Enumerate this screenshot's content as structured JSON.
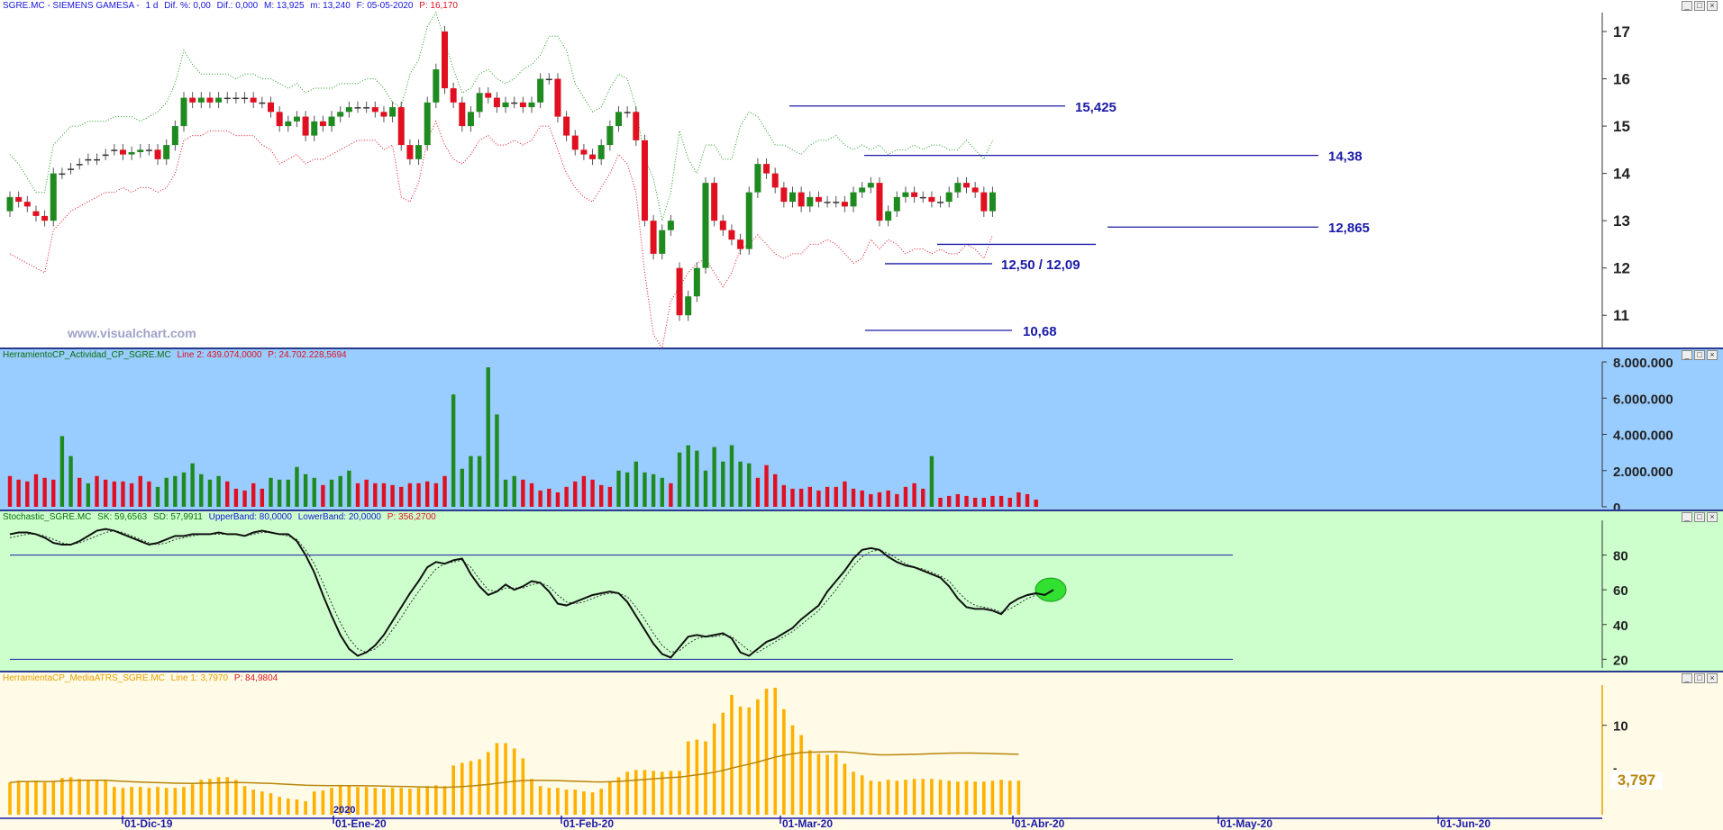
{
  "panels": {
    "price": {
      "title": {
        "symbol": "SGRE.MC - SIEMENS GAMESA -",
        "period": "1 d",
        "dif_pct": "Dif. %: 0,00",
        "dif": "Dif.: 0,000",
        "max": "M: 13,925",
        "min": "m: 13,240",
        "fecha": "F: 05-05-2020",
        "p": "P: 16,170"
      },
      "watermark": "www.visualchart.com"
    },
    "volume": {
      "title": {
        "name": "HerramientoCP_Actividad_CP_SGRE.MC",
        "line": "Line 2: 439.074,0000",
        "p": "P: 24.702.228,5694"
      }
    },
    "stochastic": {
      "title": {
        "name": "Stochastic_SGRE.MC",
        "sk": "SK: 59,6563",
        "sd": "SD: 57,9911",
        "upper": "UpperBand: 80,0000",
        "lower": "LowerBand: 20,0000",
        "p": "P: 356,2700"
      }
    },
    "atr": {
      "title": {
        "name": "HerramientaCP_MediaATRS_SGRE.MC",
        "line": "Line 1: 3,7970",
        "p": "P: 84,9804"
      },
      "last_value": "3,797"
    }
  },
  "colors": {
    "bull": "#1f8a1f",
    "bear": "#e01020",
    "neutral": "#1414d8",
    "level": "#1a1aa8",
    "upper_band": "#1f9d1f",
    "lower_band": "#e01020",
    "vol_bg": "#99ccff",
    "stoch_bg": "#ccffcc",
    "atr_bg": "#fffbe6",
    "atr_bar": "#ffb000",
    "atr_avg": "#b8860b"
  },
  "chart_data": [
    {
      "type": "candlestick",
      "title": "SGRE.MC - SIEMENS GAMESA - 1 d",
      "y_ticks": [
        "11",
        "12",
        "13",
        "14",
        "15",
        "16",
        "17"
      ],
      "ylim": [
        10.3,
        17.4
      ],
      "x_labels": [
        "01-Dic-19",
        "01-Ene-20",
        "01-Feb-20",
        "01-Mar-20",
        "01-Abr-20",
        "01-May-20",
        "01-Jun-20"
      ],
      "year_label": "2020",
      "levels": [
        {
          "label": "15,425",
          "value": 15.425
        },
        {
          "label": "14,38",
          "value": 14.38
        },
        {
          "label": "12,865",
          "value": 12.865
        },
        {
          "label": "12,50 / 12,09",
          "value": 12.5,
          "value2": 12.09
        },
        {
          "label": "10,68",
          "value": 10.68
        }
      ],
      "closes": [
        13.5,
        13.4,
        13.3,
        13.1,
        13.0,
        14.0,
        14.0,
        14.1,
        14.2,
        14.3,
        14.3,
        14.4,
        14.5,
        14.4,
        14.45,
        14.5,
        14.5,
        14.3,
        14.6,
        15.0,
        15.6,
        15.5,
        15.6,
        15.5,
        15.6,
        15.6,
        15.6,
        15.6,
        15.5,
        15.5,
        15.3,
        15.0,
        15.1,
        15.2,
        14.8,
        15.1,
        15.0,
        15.2,
        15.3,
        15.4,
        15.4,
        15.4,
        15.3,
        15.2,
        15.4,
        14.6,
        14.3,
        14.6,
        15.5,
        16.2,
        15.8,
        15.5,
        15.0,
        15.3,
        15.7,
        15.6,
        15.4,
        15.5,
        15.5,
        15.4,
        15.5,
        16.0,
        16.0,
        15.2,
        14.8,
        14.5,
        14.4,
        14.3,
        14.6,
        15.0,
        15.3,
        15.3,
        14.7,
        13.0,
        12.3,
        12.8,
        13.0,
        11.0,
        11.4,
        12.0,
        13.8,
        13.0,
        12.8,
        12.6,
        12.4,
        13.6,
        14.2,
        14.0,
        13.7,
        13.4,
        13.6,
        13.3,
        13.5,
        13.4,
        13.4,
        13.4,
        13.3,
        13.6,
        13.7,
        13.8,
        13.0,
        13.2,
        13.5,
        13.6,
        13.5,
        13.5,
        13.4,
        13.4,
        13.6,
        13.8,
        13.7,
        13.6,
        13.2,
        13.6
      ],
      "opens": [
        13.2,
        13.5,
        13.4,
        13.2,
        13.1,
        13.0,
        14.0,
        14.1,
        14.2,
        14.3,
        14.3,
        14.4,
        14.5,
        14.5,
        14.4,
        14.45,
        14.5,
        14.5,
        14.3,
        14.6,
        15.0,
        15.6,
        15.5,
        15.6,
        15.5,
        15.6,
        15.6,
        15.6,
        15.6,
        15.5,
        15.5,
        15.3,
        15.0,
        15.1,
        15.2,
        14.8,
        15.1,
        15.0,
        15.2,
        15.3,
        15.4,
        15.4,
        15.4,
        15.3,
        15.2,
        15.4,
        14.6,
        14.3,
        14.6,
        15.5,
        17.0,
        15.8,
        15.5,
        15.0,
        15.3,
        15.7,
        15.6,
        15.4,
        15.5,
        15.5,
        15.4,
        15.5,
        16.0,
        16.0,
        15.2,
        14.8,
        14.5,
        14.4,
        14.3,
        14.6,
        15.0,
        15.3,
        15.3,
        14.7,
        13.0,
        12.3,
        12.8,
        12.0,
        11.0,
        11.4,
        12.0,
        13.8,
        13.0,
        12.8,
        12.6,
        12.4,
        13.6,
        14.2,
        14.0,
        13.7,
        13.4,
        13.6,
        13.3,
        13.5,
        13.4,
        13.4,
        13.4,
        13.3,
        13.6,
        13.7,
        13.8,
        13.0,
        13.2,
        13.5,
        13.6,
        13.5,
        13.5,
        13.4,
        13.4,
        13.6,
        13.8,
        13.7,
        13.6,
        13.2
      ],
      "upper_band": [
        14.4,
        14.2,
        13.9,
        13.6,
        13.6,
        14.6,
        14.8,
        15.0,
        15.0,
        15.1,
        15.1,
        15.1,
        15.2,
        15.2,
        15.2,
        15.1,
        15.2,
        15.3,
        15.5,
        15.9,
        16.6,
        16.3,
        16.1,
        16.1,
        16.1,
        16.1,
        16.0,
        16.1,
        16.1,
        16.0,
        16.0,
        15.9,
        15.8,
        15.9,
        15.7,
        15.8,
        15.8,
        15.8,
        15.9,
        15.9,
        15.9,
        16.0,
        16.0,
        15.8,
        15.5,
        15.4,
        16.1,
        16.4,
        17.1,
        17.4,
        16.8,
        16.2,
        15.7,
        15.8,
        16.1,
        16.2,
        16.0,
        15.9,
        16.0,
        16.2,
        16.3,
        16.5,
        16.9,
        16.9,
        16.6,
        15.9,
        15.6,
        15.3,
        15.4,
        15.8,
        16.1,
        16.0,
        15.4,
        14.3,
        13.9,
        13.0,
        13.6,
        14.9,
        14.3,
        14.0,
        14.6,
        14.6,
        14.3,
        14.3,
        15.0,
        15.3,
        15.2,
        14.9,
        14.6,
        14.6,
        14.5,
        14.4,
        14.6,
        14.7,
        14.7,
        14.8,
        14.6,
        14.5,
        14.6,
        14.5,
        14.6,
        14.4,
        14.5,
        14.5,
        14.6,
        14.5,
        14.6,
        14.6,
        14.5,
        14.5,
        14.7,
        14.5,
        14.3,
        14.7
      ],
      "lower_band": [
        12.3,
        12.2,
        12.1,
        12.0,
        11.9,
        12.8,
        13.0,
        13.2,
        13.3,
        13.4,
        13.5,
        13.6,
        13.6,
        13.7,
        13.6,
        13.7,
        13.7,
        13.6,
        13.7,
        14.0,
        14.7,
        14.8,
        14.8,
        14.9,
        14.9,
        14.9,
        14.8,
        14.8,
        14.8,
        14.6,
        14.5,
        14.2,
        14.3,
        14.4,
        14.2,
        14.3,
        14.3,
        14.4,
        14.5,
        14.6,
        14.7,
        14.7,
        14.7,
        14.5,
        14.6,
        13.5,
        13.4,
        13.8,
        14.7,
        15.1,
        14.6,
        14.3,
        14.2,
        14.4,
        14.7,
        14.8,
        14.6,
        14.6,
        14.7,
        14.6,
        14.7,
        15.0,
        15.0,
        14.5,
        14.0,
        13.7,
        13.5,
        13.4,
        13.7,
        14.0,
        14.4,
        14.2,
        13.6,
        11.9,
        10.6,
        10.3,
        11.3,
        11.6,
        11.9,
        12.1,
        12.2,
        11.9,
        11.6,
        11.9,
        12.4,
        12.5,
        12.7,
        12.5,
        12.3,
        12.2,
        12.3,
        12.3,
        12.5,
        12.5,
        12.6,
        12.5,
        12.3,
        12.1,
        12.2,
        12.6,
        12.4,
        12.6,
        12.5,
        12.3,
        12.4,
        12.4,
        12.3,
        12.4,
        12.3,
        12.3,
        12.5,
        12.4,
        12.2,
        12.7
      ]
    },
    {
      "type": "bar",
      "title": "HerramientoCP_Actividad_CP_SGRE.MC",
      "y_ticks": [
        "0",
        "2.000.000",
        "4.000.000",
        "6.000.000",
        "8.000.000"
      ],
      "ylim": [
        0,
        8000000
      ],
      "values": [
        1700000,
        1500000,
        1400000,
        1800000,
        1600000,
        1500000,
        3900000,
        2800000,
        1600000,
        1300000,
        1700000,
        1500000,
        1400000,
        1400000,
        1300000,
        1700000,
        1400000,
        1100000,
        1600000,
        1700000,
        1900000,
        2400000,
        1800000,
        1500000,
        1700000,
        1400000,
        1000000,
        900000,
        1300000,
        1000000,
        1600000,
        1500000,
        1500000,
        2200000,
        1800000,
        1600000,
        1200000,
        1500000,
        1700000,
        2000000,
        1300000,
        1500000,
        1300000,
        1300000,
        1200000,
        1100000,
        1300000,
        1300000,
        1400000,
        1300000,
        1700000,
        6200000,
        2100000,
        2800000,
        2800000,
        7700000,
        5100000,
        1500000,
        1700000,
        1500000,
        1300000,
        900000,
        1000000,
        800000,
        1100000,
        1400000,
        1700000,
        1500000,
        1200000,
        1100000,
        2000000,
        1900000,
        2500000,
        1900000,
        1800000,
        1600000,
        1300000,
        3000000,
        3400000,
        3100000,
        2000000,
        3300000,
        2500000,
        3400000,
        2500000,
        2400000,
        1600000,
        2300000,
        1800000,
        1200000,
        1000000,
        1000000,
        1100000,
        900000,
        1100000,
        1100000,
        1400000,
        1000000,
        900000,
        700000,
        800000,
        900000,
        700000,
        1100000,
        1300000,
        1000000,
        2800000,
        500000,
        600000,
        700000,
        600000,
        500000,
        500000,
        600000,
        600000,
        500000,
        800000,
        700000,
        400000
      ],
      "bar_up": [
        false,
        false,
        false,
        false,
        false,
        false,
        true,
        true,
        false,
        true,
        false,
        false,
        false,
        false,
        false,
        false,
        false,
        true,
        true,
        true,
        true,
        true,
        true,
        true,
        true,
        false,
        false,
        false,
        false,
        false,
        true,
        true,
        true,
        true,
        true,
        true,
        false,
        true,
        true,
        true,
        false,
        false,
        false,
        false,
        false,
        false,
        false,
        false,
        false,
        false,
        false,
        true,
        true,
        true,
        true,
        true,
        true,
        true,
        true,
        false,
        false,
        false,
        false,
        false,
        false,
        false,
        false,
        false,
        false,
        false,
        true,
        true,
        true,
        true,
        true,
        true,
        false,
        true,
        true,
        true,
        true,
        true,
        true,
        true,
        true,
        true,
        false,
        false,
        false,
        false,
        false,
        false,
        false,
        false,
        false,
        false,
        false,
        false,
        false,
        false,
        false,
        false,
        false,
        false,
        false,
        false,
        true,
        false,
        false,
        false,
        false,
        false,
        false,
        false,
        false,
        false,
        false,
        false,
        false
      ]
    },
    {
      "type": "line",
      "title": "Stochastic_SGRE.MC",
      "y_ticks": [
        "20",
        "40",
        "60",
        "80"
      ],
      "ylim": [
        15,
        100
      ],
      "bands": [
        80,
        20
      ],
      "series": [
        {
          "name": "SK",
          "values": [
            92,
            93,
            93,
            92,
            90,
            87,
            86,
            86,
            88,
            91,
            94,
            95,
            94,
            92,
            90,
            88,
            86,
            87,
            89,
            91,
            91,
            92,
            92,
            92,
            93,
            92,
            92,
            91,
            93,
            94,
            93,
            92,
            92,
            88,
            80,
            70,
            57,
            45,
            34,
            26,
            22,
            24,
            28,
            34,
            42,
            50,
            58,
            65,
            73,
            76,
            75,
            77,
            78,
            69,
            62,
            57,
            59,
            63,
            60,
            62,
            65,
            64,
            59,
            52,
            51,
            53,
            55,
            57,
            58,
            59,
            58,
            53,
            45,
            37,
            29,
            23,
            21,
            27,
            33,
            34,
            33,
            34,
            35,
            32,
            24,
            22,
            26,
            30,
            32,
            35,
            38,
            43,
            47,
            51,
            59,
            65,
            71,
            78,
            83,
            84,
            83,
            79,
            76,
            74,
            73,
            71,
            69,
            67,
            62,
            55,
            50,
            49,
            49,
            48,
            46,
            52,
            55,
            57,
            58,
            57,
            60
          ]
        },
        {
          "name": "SD",
          "values": [
            90,
            91,
            92,
            92,
            91,
            89,
            87,
            86,
            87,
            89,
            91,
            93,
            94,
            93,
            91,
            89,
            87,
            86,
            87,
            89,
            90,
            91,
            92,
            92,
            92,
            92,
            92,
            91,
            92,
            93,
            93,
            92,
            91,
            89,
            83,
            75,
            64,
            52,
            41,
            32,
            26,
            24,
            26,
            30,
            37,
            44,
            52,
            59,
            66,
            72,
            75,
            76,
            77,
            73,
            66,
            60,
            59,
            61,
            61,
            61,
            63,
            64,
            62,
            57,
            53,
            52,
            53,
            55,
            57,
            58,
            58,
            56,
            50,
            43,
            35,
            28,
            24,
            25,
            29,
            32,
            33,
            33,
            34,
            33,
            29,
            25,
            24,
            27,
            30,
            33,
            36,
            40,
            44,
            48,
            54,
            60,
            67,
            74,
            79,
            82,
            83,
            81,
            78,
            75,
            73,
            72,
            70,
            68,
            65,
            59,
            54,
            51,
            50,
            49,
            47,
            49,
            52,
            55,
            57,
            58,
            58
          ]
        }
      ]
    },
    {
      "type": "bar",
      "title": "HerramientaCP_MediaATRS_SGRE.MC",
      "y_ticks": [
        "-",
        "10"
      ],
      "ylim": [
        0,
        14.5
      ],
      "values": [
        3.6,
        3.8,
        3.7,
        3.8,
        3.6,
        3.8,
        4.1,
        4.2,
        4.0,
        3.9,
        3.9,
        3.8,
        3.1,
        3.0,
        3.1,
        3.1,
        3.0,
        3.1,
        3.0,
        3.0,
        3.1,
        3.4,
        3.9,
        4.0,
        4.2,
        4.2,
        3.9,
        3.2,
        2.8,
        2.6,
        2.4,
        2.0,
        1.8,
        1.7,
        1.5,
        2.6,
        2.7,
        3.0,
        3.3,
        3.2,
        3.1,
        3.1,
        3.0,
        2.9,
        3.0,
        3.0,
        2.9,
        3.0,
        3.2,
        3.3,
        3.2,
        5.5,
        5.8,
        6.0,
        6.2,
        7.0,
        8.0,
        8.0,
        7.4,
        6.3,
        4.0,
        3.2,
        3.0,
        3.0,
        2.8,
        2.8,
        2.6,
        2.5,
        2.9,
        3.7,
        4.2,
        4.8,
        5.0,
        5.0,
        4.9,
        4.8,
        4.9,
        4.9,
        8.2,
        8.4,
        8.2,
        10.2,
        11.4,
        13.4,
        12.1,
        12.0,
        12.9,
        14.1,
        14.2,
        11.8,
        10.0,
        8.9,
        7.2,
        6.8,
        6.7,
        6.8,
        5.7,
        4.8,
        4.4,
        3.8,
        3.7,
        3.9,
        3.8,
        3.9,
        4.0,
        4.0,
        4.0,
        3.9,
        3.8,
        3.7,
        3.8,
        3.7,
        3.7,
        3.8,
        3.9,
        3.8,
        3.8
      ],
      "series": [
        {
          "name": "Line 1",
          "value": 3.797
        }
      ]
    }
  ]
}
